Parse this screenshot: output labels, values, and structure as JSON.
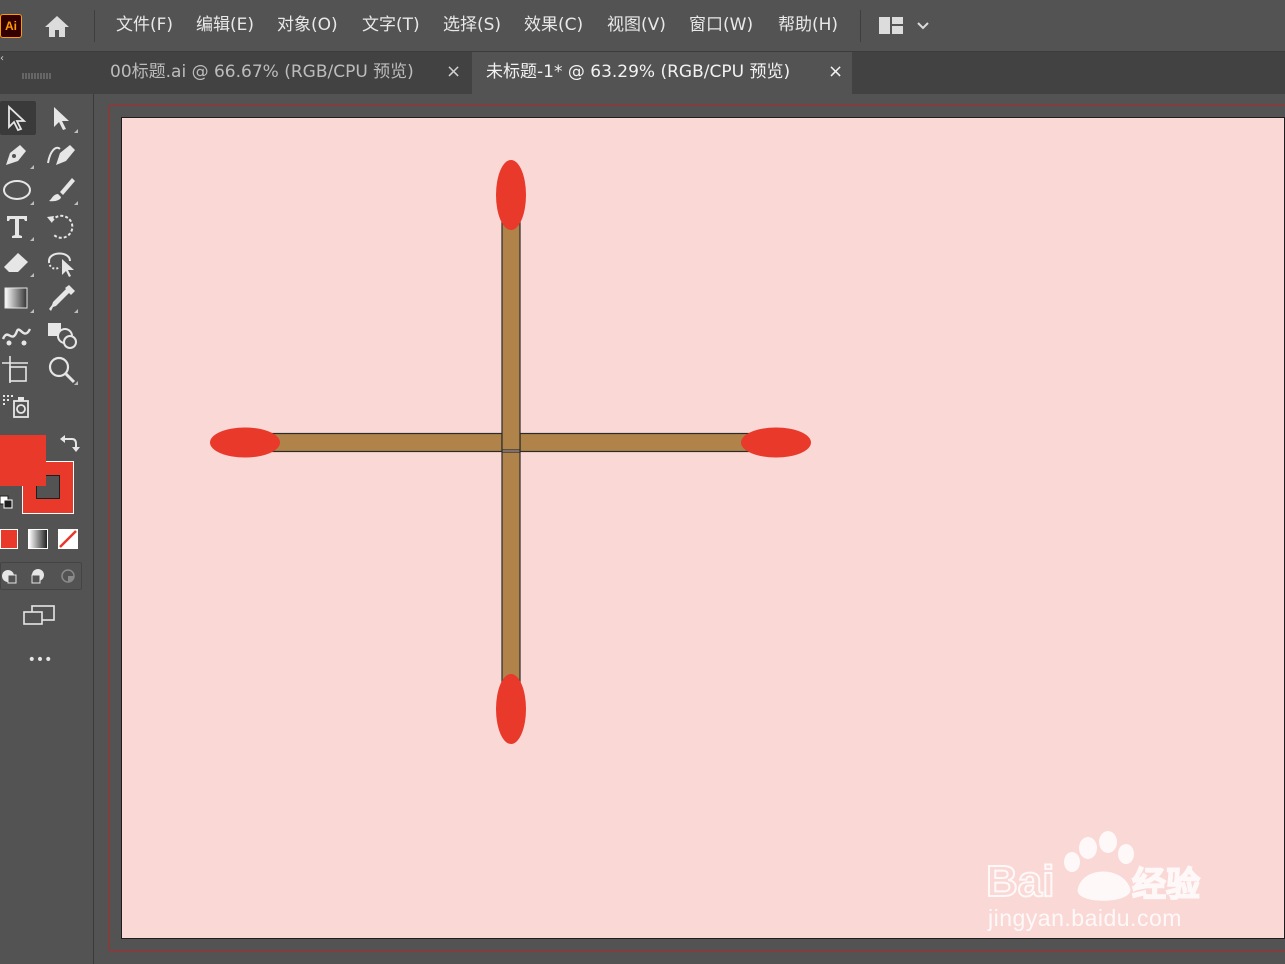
{
  "app": {
    "logo": "Ai",
    "home_icon": "home-icon",
    "accent_color": "#ff9a00"
  },
  "menu": {
    "items": [
      {
        "label": "文件(F)"
      },
      {
        "label": "编辑(E)"
      },
      {
        "label": "对象(O)"
      },
      {
        "label": "文字(T)"
      },
      {
        "label": "选择(S)"
      },
      {
        "label": "效果(C)"
      },
      {
        "label": "视图(V)"
      },
      {
        "label": "窗口(W)"
      },
      {
        "label": "帮助(H)"
      }
    ],
    "workspace_icon": "workspace-layout-icon"
  },
  "tabs": [
    {
      "label": "00标题.ai @ 66.67% (RGB/CPU 预览)",
      "close": "×",
      "active": false
    },
    {
      "label": "未标题-1* @ 63.29% (RGB/CPU 预览)",
      "close": "×",
      "active": true
    }
  ],
  "tools": [
    {
      "name": "selection-tool-icon"
    },
    {
      "name": "direct-selection-tool-icon"
    },
    {
      "name": "pen-tool-icon"
    },
    {
      "name": "curvature-tool-icon"
    },
    {
      "name": "ellipse-tool-icon"
    },
    {
      "name": "paintbrush-tool-icon"
    },
    {
      "name": "type-tool-icon"
    },
    {
      "name": "rotate-tool-icon"
    },
    {
      "name": "eraser-tool-icon"
    },
    {
      "name": "free-transform-tool-icon"
    },
    {
      "name": "gradient-tool-icon"
    },
    {
      "name": "eyedropper-tool-icon"
    },
    {
      "name": "symbol-sprayer-tool-icon"
    },
    {
      "name": "shape-builder-tool-icon"
    },
    {
      "name": "artboard-tool-icon"
    },
    {
      "name": "zoom-tool-icon"
    },
    {
      "name": "perspective-grid-tool-icon"
    }
  ],
  "colors": {
    "fill": "#e8392b",
    "stroke": "#e8392b",
    "artboard_background": "#f9d8d6",
    "match_stick": "#b0834a",
    "match_head": "#e8392b"
  },
  "more_tools_label": "•••",
  "watermark": {
    "brand": "Bai du 经验",
    "url": "jingyan.baidu.com"
  }
}
